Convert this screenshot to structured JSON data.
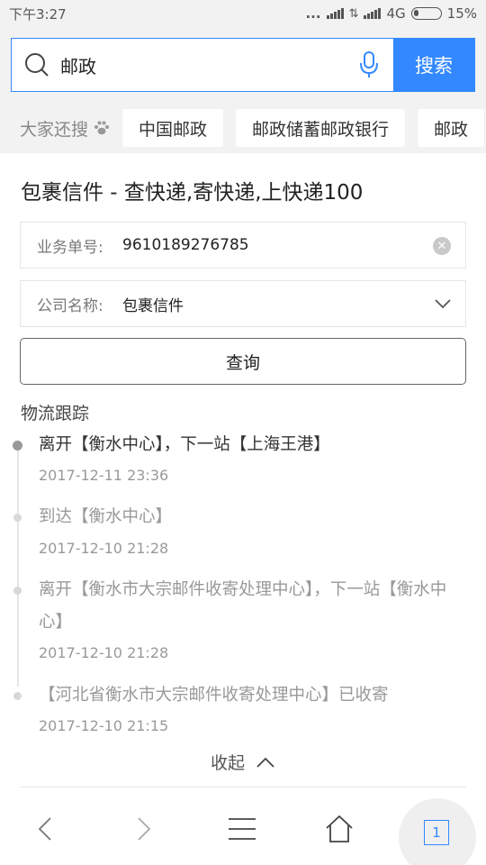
{
  "status_bar": {
    "time": "下午3:27",
    "dots": "...",
    "network": "4G",
    "battery": "15%"
  },
  "search": {
    "query": "邮政",
    "button_label": "搜索"
  },
  "hot_searches": {
    "label": "大家还搜",
    "items": [
      "中国邮政",
      "邮政储蓄邮政银行",
      "邮政"
    ]
  },
  "result": {
    "title": "包裹信件 - 查快递,寄快递,上快递100",
    "tracking_label": "业务单号:",
    "tracking_number": "9610189276785",
    "company_label": "公司名称:",
    "company_value": "包裹信件",
    "query_button": "查询",
    "logistics_title": "物流跟踪",
    "events": [
      {
        "text": "离开【衡水中心】，下一站【上海王港】",
        "time": "2017-12-11 23:36"
      },
      {
        "text": "到达【衡水中心】",
        "time": "2017-12-10 21:28"
      },
      {
        "text": "离开【衡水市大宗邮件收寄处理中心】，下一站【衡水中心】",
        "time": "2017-12-10 21:28"
      },
      {
        "text": "【河北省衡水市大宗邮件收寄处理中心】已收寄",
        "time": "2017-12-10 21:15"
      }
    ],
    "collapse_label": "收起"
  },
  "bottom_nav": {
    "tab_count": "1"
  },
  "colors": {
    "accent": "#3388ff",
    "background": "#f2f2f2"
  },
  "icons": [
    "search-icon",
    "microphone-icon",
    "paw-icon",
    "clear-icon",
    "chevron-down-icon",
    "chevron-up-icon",
    "back-arrow-icon",
    "forward-arrow-icon",
    "menu-icon",
    "home-icon",
    "tabs-icon"
  ]
}
